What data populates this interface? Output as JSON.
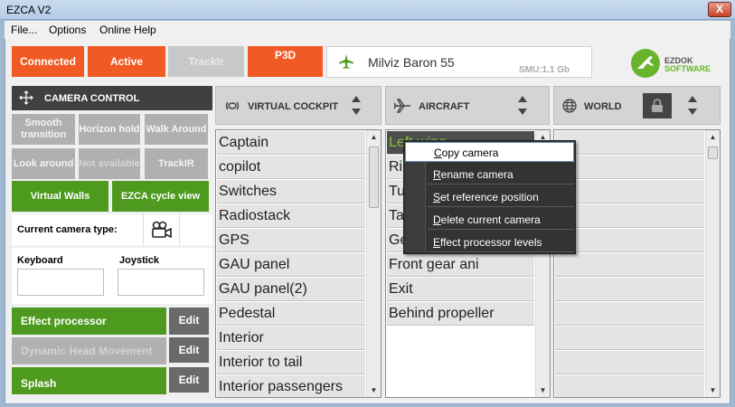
{
  "window": {
    "title": "EZCA V2",
    "close_glyph": "X"
  },
  "menu": [
    "File...",
    "Options",
    "Online Help"
  ],
  "toolbar": {
    "connected": "Connected",
    "active": "Active",
    "trackir": "TrackIr",
    "sim": "P3D",
    "aircraft_name": "Milviz Baron 55",
    "smu": "SMU:1.1 Gb",
    "logo_line1": "EZDOK",
    "logo_line2": "SOFTWARE"
  },
  "camera_control": {
    "title": "CAMERA CONTROL",
    "buttons": [
      "Smooth transition",
      "Horizon hold",
      "Walk Around",
      "Look around",
      "Not available",
      "TrackIR"
    ],
    "virtual_walls": "Virtual Walls",
    "cycle_view": "EZCA cycle view",
    "current_type_label": "Current camera type:",
    "keyboard_label": "Keyboard",
    "joystick_label": "Joystick",
    "keyboard_value": "",
    "joystick_value": "",
    "effects": [
      {
        "label": "Effect  processor",
        "edit": "Edit",
        "enabled": true
      },
      {
        "label": "Dynamic Head Movement",
        "edit": "Edit",
        "enabled": false
      },
      {
        "label": "Splash",
        "edit": "Edit",
        "enabled": true
      }
    ]
  },
  "columns": {
    "virtual_cockpit": {
      "title": "VIRTUAL COCKPIT",
      "items": [
        "Captain",
        "copilot",
        "Switches",
        "Radiostack",
        "GPS",
        "GAU panel",
        "GAU panel(2)",
        "Pedestal",
        "Interior",
        "Interior to tail",
        "Interior passengers"
      ]
    },
    "aircraft": {
      "title": "AIRCRAFT",
      "items": [
        "Left wing",
        "Ri",
        "Tu",
        "Ta",
        "Ge",
        "Front gear ani",
        "Exit",
        "Behind propeller"
      ],
      "selected_index": 0
    },
    "world": {
      "title": "WORLD",
      "items": [
        "",
        "",
        "",
        "",
        "",
        "",
        "",
        "",
        "",
        "",
        ""
      ]
    }
  },
  "context_menu": {
    "items": [
      "Copy camera",
      "Rename camera",
      "Set reference position",
      "Delete current camera",
      "Effect processor levels"
    ],
    "highlighted_index": 0
  },
  "colors": {
    "orange": "#f15a24",
    "green": "#4e9a1f",
    "dark": "#404040",
    "selected_text": "#7dc242"
  }
}
